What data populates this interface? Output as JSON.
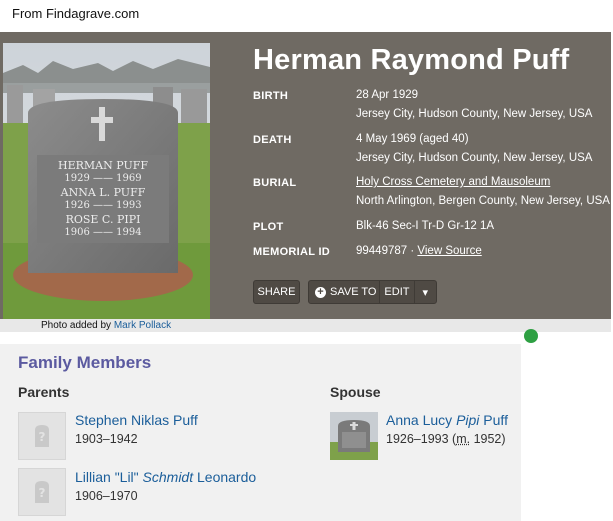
{
  "source_note": "From Findagrave.com",
  "memorial": {
    "name": "Herman Raymond Puff",
    "birth": {
      "label": "BIRTH",
      "date": "28 Apr 1929",
      "place": "Jersey City, Hudson County, New Jersey, USA"
    },
    "death": {
      "label": "DEATH",
      "date": "4 May 1969 (aged 40)",
      "place": "Jersey City, Hudson County, New Jersey, USA"
    },
    "burial": {
      "label": "BURIAL",
      "cemetery": "Holy Cross Cemetery and Mausoleum",
      "place": "North Arlington, Bergen County, New Jersey, USA"
    },
    "plot": {
      "label": "PLOT",
      "value": "Blk-46 Sec-I Tr-D Gr-12 1A"
    },
    "memorial_id": {
      "label": "MEMORIAL ID",
      "value": "99449787",
      "separator": " · ",
      "link": "View Source"
    }
  },
  "headstone_inscription": [
    {
      "name": "HERMAN PUFF",
      "years": "1929 —— 1969"
    },
    {
      "name": "ANNA L. PUFF",
      "years": "1926 —— 1993"
    },
    {
      "name": "ROSE C. PIPI",
      "years": "1906 —— 1994"
    }
  ],
  "actions": {
    "share": "SHARE",
    "save_to": "SAVE TO",
    "edit": "EDIT",
    "more": "▾"
  },
  "photo_credit": {
    "prefix": "Photo added by ",
    "author": "Mark Pollack"
  },
  "family": {
    "title": "Family Members",
    "parents_label": "Parents",
    "spouse_label": "Spouse",
    "parents": [
      {
        "first": "Stephen Niklas Puff",
        "maiden": "",
        "last": "",
        "dates": "1903–1942"
      },
      {
        "first": "Lillian \"Lil\" ",
        "maiden": "Schmidt",
        "last": " Leonardo",
        "dates": "1906–1970"
      }
    ],
    "spouse": {
      "first": "Anna Lucy ",
      "maiden": "Pipi",
      "last": " Puff",
      "dates": "1926–1993 (",
      "marriage_abbr": "m.",
      "marriage_year": " 1952)"
    }
  },
  "colors": {
    "hero_bg": "#6f6a63",
    "link": "#1b5e9a",
    "family_title": "#5b5aa0",
    "button_bg": "#4f4a44"
  },
  "icons": [
    "plus-circle-icon",
    "chevron-down-icon",
    "placeholder-headstone-icon"
  ]
}
